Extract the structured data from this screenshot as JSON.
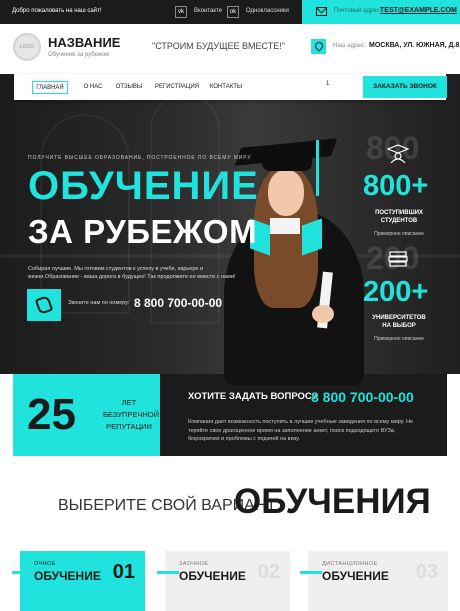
{
  "topbar": {
    "welcome": "Добро пожаловать на наш сайт!",
    "social": [
      {
        "icon": "vk-icon",
        "glyph": "vk",
        "label": "Вконтакте"
      },
      {
        "icon": "ok-icon",
        "glyph": "ok",
        "label": "Одноклассники"
      }
    ],
    "email_label": "Почтовый адрес:",
    "email": "TEST@EXAMPLE.COM"
  },
  "header": {
    "logo_text": "LOGO",
    "site_name": "НАЗВАНИЕ",
    "site_sub": "Обучение за рубежом",
    "slogan": "\"СТРОИМ БУДУЩЕЕ ВМЕСТЕ!\"",
    "address_label": "Наш адрес:",
    "address": "МОСКВА, УЛ. ЮЖНАЯ, Д.8"
  },
  "nav": {
    "items": [
      "ГЛАВНАЯ",
      "О НАС",
      "ОТЗЫВЫ",
      "РЕГИСТРАЦИЯ",
      "КОНТАКТЫ"
    ],
    "counter": "1",
    "call_button": "ЗАКАЗАТЬ ЗВОНОК"
  },
  "hero": {
    "kicker": "ПОЛУЧИТЕ ВЫСШЕЕ ОБРАЗОВАНИЕ, ПОСТРОЕННОЕ ПО ВСЕМУ МИРУ",
    "title_line1": "ОБУЧЕНИЕ",
    "title_line2": "ЗА РУБЕЖОМ",
    "description": "Собирая лучшие. Мы готовим студентов к успеху в учебе, карьере и жизни.Образование - ваша дорога в будущее! Так продолжите ее вместе с нами!",
    "call_label": "Звоните нам по номеру:",
    "phone": "8 800 700-00-00"
  },
  "stats": [
    {
      "icon": "graduate-icon",
      "ghost": "800",
      "value": "800+",
      "label": "ПОСТУПИВШИХ СТУДЕНТОВ",
      "sub": "Примерное описание"
    },
    {
      "icon": "books-icon",
      "ghost": "200",
      "value": "200+",
      "label": "УНИВЕРСИТЕТОВ НА ВЫБОР",
      "sub": "Примерное описание"
    }
  ],
  "band": {
    "years": "25",
    "years_word1": "ЛЕТ",
    "years_word2": "БЕЗУПРЕЧНОЙ",
    "years_word3": "РЕПУТАЦИИ",
    "question": "ХОТИТЕ ЗАДАТЬ ВОПРОС?",
    "phone": "8 800 700-00-00",
    "description": "Компания дает возможность поступить в лучшие учебные заведения по всему миру. Не теряйте свое драгоценное время на заполнение анкет, поиск подходящего ВУЗа, бюрократию и проблемы с подачей на визу."
  },
  "choose": {
    "prefix": "ВЫБЕРИТЕ СВОЙ ВАРИАНТ",
    "highlight": "ОБУЧЕНИЯ",
    "cards": [
      {
        "small": "ОЧНОЕ",
        "big": "ОБУЧЕНИЕ",
        "num": "01"
      },
      {
        "small": "ЗАОЧНОЕ",
        "big": "ОБУЧЕНИЕ",
        "num": "02"
      },
      {
        "small": "ДИСТАНЦИОННОЕ",
        "big": "ОБУЧЕНИЕ",
        "num": "03"
      }
    ]
  },
  "colors": {
    "accent": "#1fe3dc",
    "dark": "#1b1b1b"
  }
}
